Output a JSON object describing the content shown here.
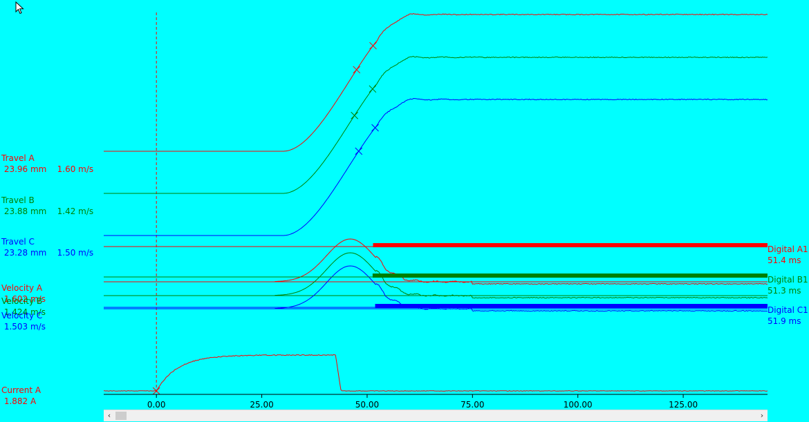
{
  "colors": {
    "background": "#00ffff",
    "a": "#ff0000",
    "b": "#008000",
    "c": "#0000ff",
    "cursor_line": "#ff0000"
  },
  "cursor_icon": "mouse-pointer-icon",
  "scrollbar": {
    "left_arrow": "‹",
    "right_arrow": "›"
  },
  "labels": {
    "travel_a": {
      "name": "Travel A",
      "value": " 23.96 mm    1.60 m/s"
    },
    "travel_b": {
      "name": "Travel B",
      "value": " 23.88 mm    1.42 m/s"
    },
    "travel_c": {
      "name": "Travel C",
      "value": " 23.28 mm    1.50 m/s"
    },
    "velocity_a": {
      "name": "Velocity A",
      "value": " 1.602 m/s"
    },
    "velocity_b": {
      "name": "Velocity B",
      "value": " 1.424 m/s"
    },
    "velocity_c": {
      "name": "Velocity C",
      "value": " 1.503 m/s"
    },
    "current_a": {
      "name": "Current A",
      "value": " 1.882 A"
    },
    "digital_a1": {
      "name": "Digital A1",
      "value": "51.4 ms"
    },
    "digital_b1": {
      "name": "Digital B1",
      "value": "51.3 ms"
    },
    "digital_c1": {
      "name": "Digital C1",
      "value": "51.9 ms"
    }
  },
  "chart_data": {
    "type": "line",
    "xlim": [
      -12.5,
      145
    ],
    "xticks": [
      "0.00",
      "25.00",
      "50.00",
      "75.00",
      "100.00",
      "125.00"
    ],
    "xtick_values": [
      0,
      25,
      50,
      75,
      100,
      125
    ],
    "cursor_x": 0,
    "travel": [
      {
        "name": "Travel A",
        "color": "a",
        "final_mm": 23.96,
        "speed": 1.6,
        "markers_x": [
          47.5,
          51.4
        ]
      },
      {
        "name": "Travel B",
        "color": "b",
        "final_mm": 23.88,
        "speed": 1.42,
        "markers_x": [
          47.0,
          51.3
        ]
      },
      {
        "name": "Travel C",
        "color": "c",
        "final_mm": 23.28,
        "speed": 1.5,
        "markers_x": [
          48.0,
          51.9
        ]
      }
    ],
    "velocity": [
      {
        "name": "Velocity A",
        "color": "a",
        "peak_ms": 1.602
      },
      {
        "name": "Velocity B",
        "color": "b",
        "peak_ms": 1.424
      },
      {
        "name": "Velocity C",
        "color": "c",
        "peak_ms": 1.503
      }
    ],
    "digital": [
      {
        "name": "Digital A1",
        "color": "a",
        "switch_ms": 51.4
      },
      {
        "name": "Digital B1",
        "color": "b",
        "switch_ms": 51.3
      },
      {
        "name": "Digital C1",
        "color": "c",
        "switch_ms": 51.9
      }
    ],
    "current": {
      "name": "Current A",
      "color": "a",
      "value_a": 1.882,
      "on_ms": 0,
      "off_ms": 42.5,
      "plateau_start_ms": 15
    }
  }
}
